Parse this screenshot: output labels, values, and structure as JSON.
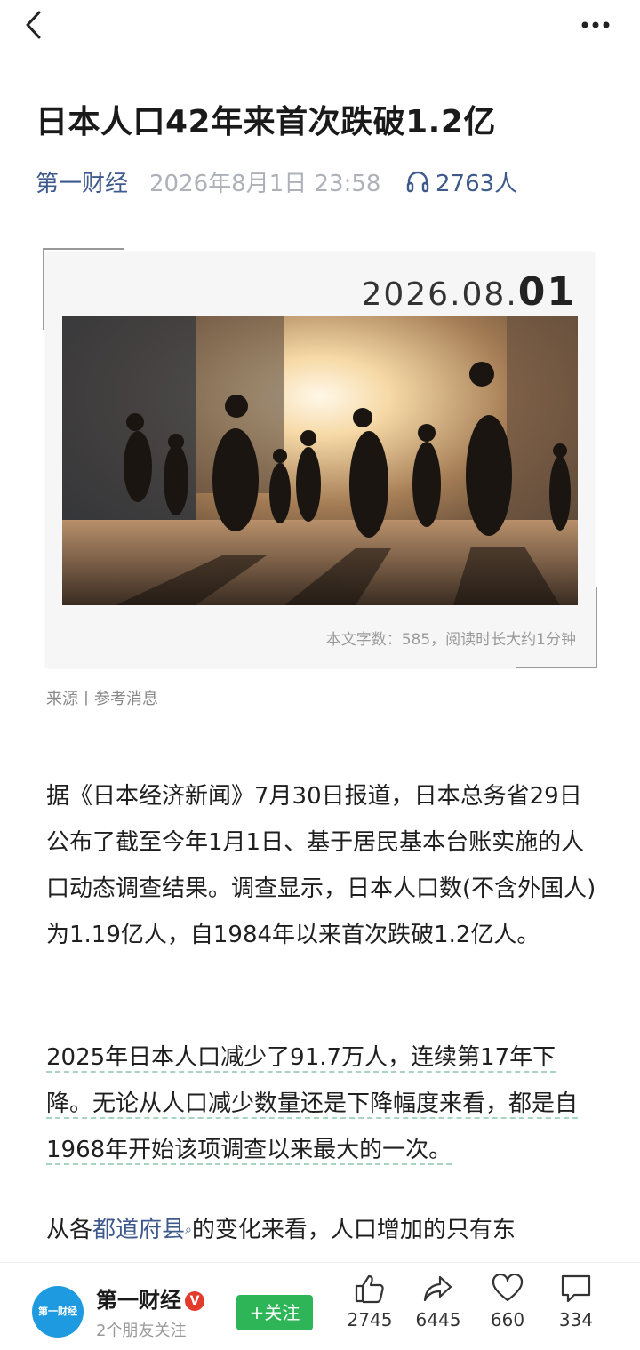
{
  "article": {
    "title": "日本人口42年来首次跌破1.2亿",
    "source": "第一财经",
    "time": "2026年8月1日 23:58",
    "listeners": "2763人"
  },
  "card": {
    "date_prefix": "2026.08.",
    "date_day": "01",
    "word_count": "本文字数：585，阅读时长大约1分钟"
  },
  "source_line": "来源丨参考消息",
  "body": {
    "p1": "据《日本经济新闻》7月30日报道，日本总务省29日公布了截至今年1月1日、基于居民基本台账实施的人口动态调查结果。调查显示，日本人口数(不含外国人)为1.19亿人，自1984年以来首次跌破1.2亿人。",
    "p2": "2025年日本人口减少了91.7万人，连续第17年下降。无论从人口减少数量还是下降幅度来看，都是自1968年开始该项调查以来最大的一次。",
    "p3_pre": "从各",
    "p3_link": "都道府县",
    "p3_post": "的变化来看，人口增加的只有东"
  },
  "bottom": {
    "logo_text": "第一财经",
    "account": "第一财经",
    "verified": "V",
    "friends": "2个朋友关注",
    "follow": "+关注",
    "likes": "2745",
    "shares": "6445",
    "favorites": "660",
    "comments": "334"
  },
  "icons": [
    "back-chevron-icon",
    "more-dots-icon",
    "headphones-icon",
    "search-mini-icon",
    "thumbs-up-icon",
    "share-arrow-icon",
    "heart-icon",
    "comment-icon"
  ]
}
